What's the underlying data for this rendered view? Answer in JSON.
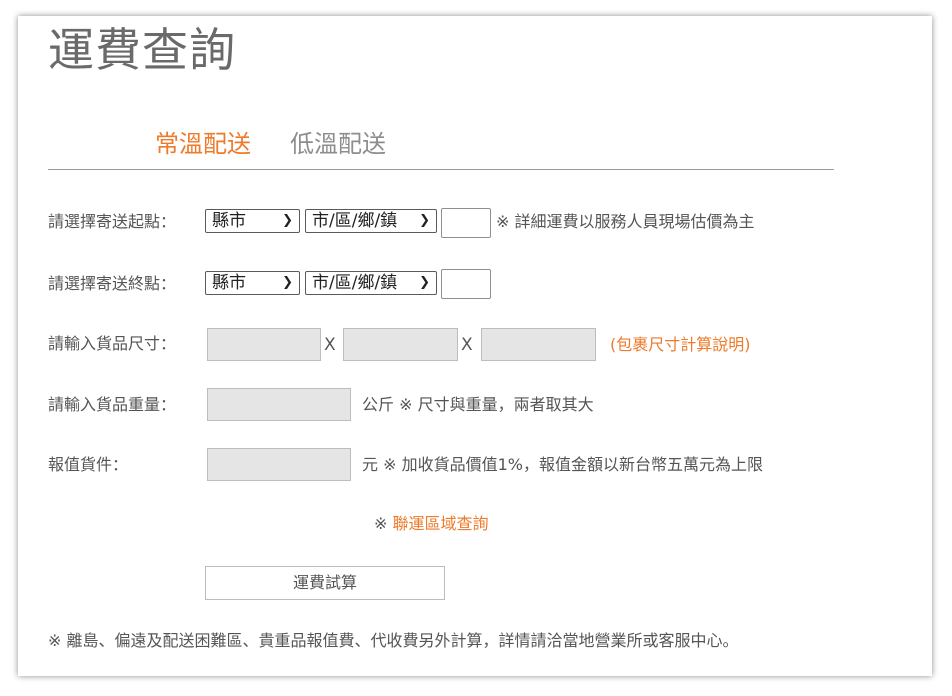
{
  "page": {
    "title": "運費查詢"
  },
  "tabs": [
    {
      "label": "常溫配送",
      "active": true
    },
    {
      "label": "低溫配送",
      "active": false
    }
  ],
  "origin": {
    "label": "請選擇寄送起點：",
    "county_value": "縣市",
    "district_value": "市/區/鄉/鎮",
    "note": "※ 詳細運費以服務人員現場估價為主"
  },
  "destination": {
    "label": "請選擇寄送終點：",
    "county_value": "縣市",
    "district_value": "市/區/鄉/鎮"
  },
  "size": {
    "label": "請輸入貨品尺寸：",
    "separator": "X",
    "open_paren": "(",
    "link": "包裹尺寸計算說明",
    "close_paren": ")"
  },
  "weight": {
    "label": "請輸入貨品重量：",
    "note": "公斤 ※ 尺寸與重量，兩者取其大"
  },
  "insured": {
    "label": "報值貨件：",
    "note": "元 ※ 加收貨品價值1%，報值金額以新台幣五萬元為上限"
  },
  "region": {
    "prefix": "※",
    "link": "聯運區域查詢"
  },
  "calculate_button": "運費試算",
  "footer_note": "※ 離島、偏遠及配送困難區、貴重品報值費、代收費另外計算，詳情請洽當地營業所或客服中心。",
  "colors": {
    "accent": "#ee7a2a",
    "text": "#555555",
    "input_grey": "#e5e5e5"
  },
  "icons": {
    "dropdown": "chevron-down-icon"
  }
}
